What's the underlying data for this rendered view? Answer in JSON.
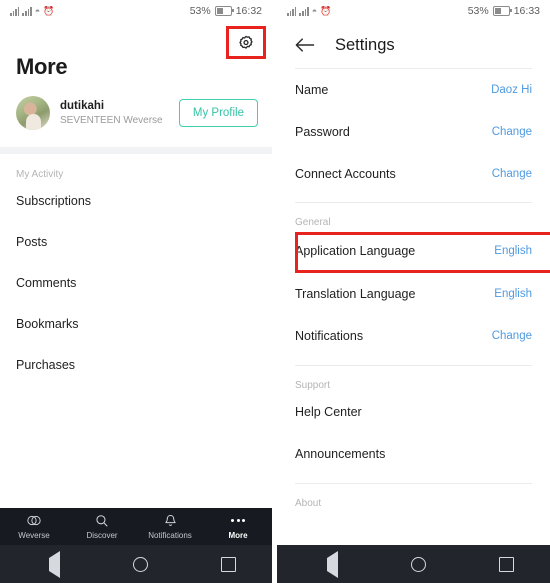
{
  "left_screen": {
    "status_bar": {
      "battery_percent": "53%",
      "time": "16:32",
      "icons": [
        "signal-bars-icon",
        "signal-bars-icon",
        "wifi-icon",
        "alarm-icon",
        "battery-icon"
      ]
    },
    "settings_gear": {
      "icon": "gear-icon",
      "highlighted": true
    },
    "page_title": "More",
    "profile": {
      "avatar": "user-avatar",
      "name": "dutikahi",
      "subtitle": "SEVENTEEN Weverse",
      "button_label": "My Profile"
    },
    "section_label": "My Activity",
    "menu_items": [
      {
        "label": "Subscriptions"
      },
      {
        "label": "Posts"
      },
      {
        "label": "Comments"
      },
      {
        "label": "Bookmarks"
      },
      {
        "label": "Purchases"
      }
    ],
    "tab_bar": [
      {
        "label": "Weverse",
        "icon": "weverse-circles-icon",
        "active": false
      },
      {
        "label": "Discover",
        "icon": "search-icon",
        "active": false
      },
      {
        "label": "Notifications",
        "icon": "bell-icon",
        "active": false
      },
      {
        "label": "More",
        "icon": "more-dots-icon",
        "active": true
      }
    ]
  },
  "right_screen": {
    "status_bar": {
      "battery_percent": "53%",
      "time": "16:33"
    },
    "app_bar": {
      "back_icon": "back-arrow-icon",
      "title": "Settings"
    },
    "account_rows": [
      {
        "label": "Name",
        "value": "Daoz Hi"
      },
      {
        "label": "Password",
        "value": "Change"
      },
      {
        "label": "Connect Accounts",
        "value": "Change"
      }
    ],
    "general_section": {
      "header": "General",
      "rows": [
        {
          "label": "Application Language",
          "value": "English",
          "highlighted": true
        },
        {
          "label": "Translation Language",
          "value": "English",
          "highlighted": false
        },
        {
          "label": "Notifications",
          "value": "Change",
          "highlighted": false
        }
      ]
    },
    "support_section": {
      "header": "Support",
      "rows": [
        {
          "label": "Help Center",
          "value": ""
        },
        {
          "label": "Announcements",
          "value": ""
        }
      ]
    },
    "about_section": {
      "header": "About"
    }
  },
  "android_nav": {
    "back": "nav-back-icon",
    "home": "nav-home-icon",
    "recents": "nav-recents-icon"
  },
  "colors": {
    "highlight_red": "#e8231e",
    "accent_teal": "#35c3a7",
    "link_blue": "#4f9ae0",
    "tabbar_dark": "#171a21",
    "navbar_dark": "#22252c"
  }
}
